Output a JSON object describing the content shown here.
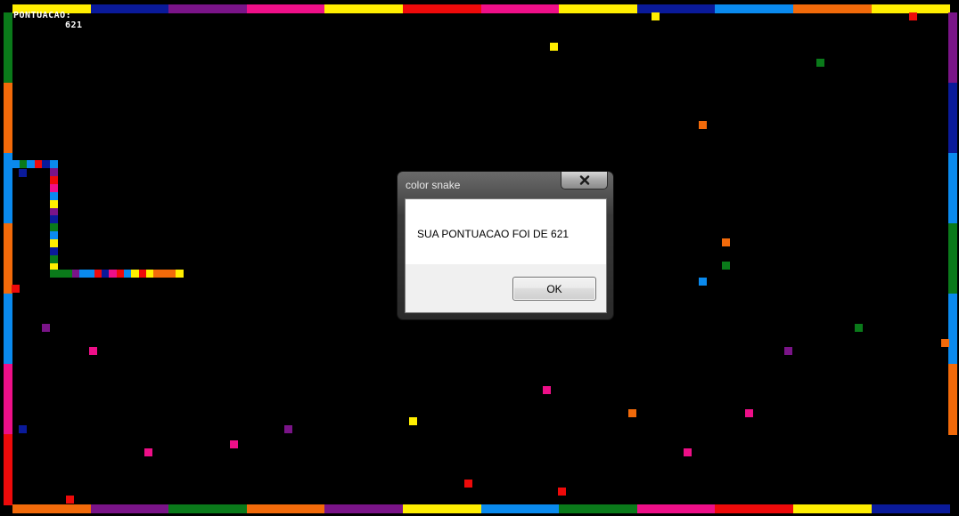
{
  "score": {
    "label": "PONTUACAO:",
    "value": "621"
  },
  "dialog": {
    "title": "color snake",
    "message": "SUA PONTUACAO FOI DE 621",
    "ok_label": "OK",
    "close_icon": "close-x-icon"
  },
  "colors": {
    "background": "#000000",
    "yellow": "#ffee00",
    "navy": "#0a1a9a",
    "purple": "#7a1488",
    "magenta": "#ee0f88",
    "red": "#ee0a0a",
    "blue": "#0a8aee",
    "orange": "#f26a0a",
    "green": "#0a7a1a"
  }
}
